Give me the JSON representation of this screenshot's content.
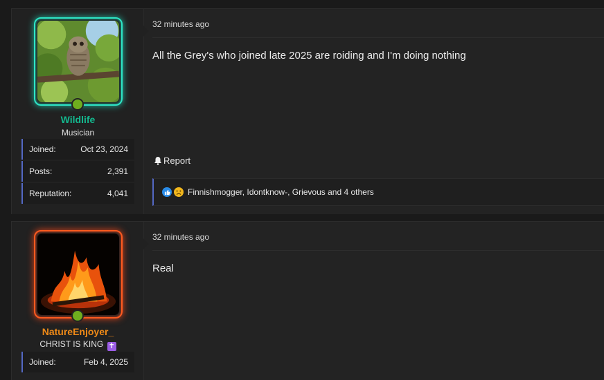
{
  "posts": [
    {
      "username": "Wildlife",
      "user_title": "Musician",
      "stats": [
        {
          "label": "Joined:",
          "value": "Oct 23, 2024"
        },
        {
          "label": "Posts:",
          "value": "2,391"
        },
        {
          "label": "Reputation:",
          "value": "4,041"
        }
      ],
      "timestamp": "32 minutes ago",
      "message": "All the Grey's who joined late 2025 are roiding and I'm doing nothing",
      "report_label": "Report",
      "reactions_text": "Finnishmogger, Idontknow-, Grievous and 4 others",
      "colors": {
        "username": "#13b98f",
        "avatar_glow": "#2ee6c6"
      }
    },
    {
      "username": "NatureEnjoyer_",
      "user_title": "CHRIST IS KING",
      "user_title_emoji": "✝",
      "stats": [
        {
          "label": "Joined:",
          "value": "Feb 4, 2025"
        }
      ],
      "timestamp": "32 minutes ago",
      "message": "Real",
      "colors": {
        "username": "#f08a17",
        "avatar_glow": "#ff5a1f"
      }
    }
  ],
  "icons": {
    "status": "online-dot-icon",
    "report": "bell-icon",
    "reaction_like": "thumbs-up-icon",
    "reaction_sad": "sad-face-icon"
  }
}
